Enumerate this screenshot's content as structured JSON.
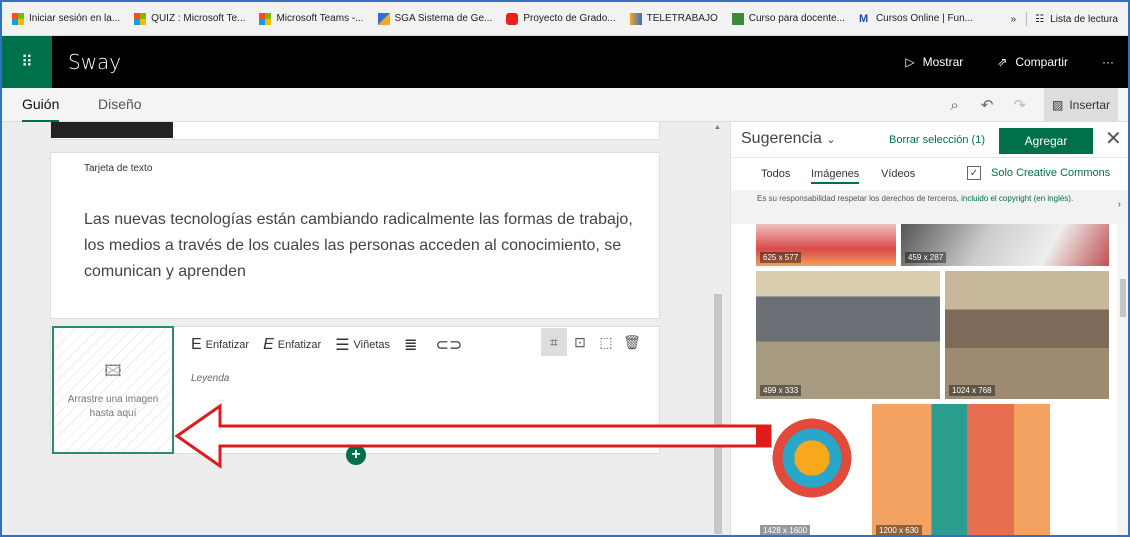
{
  "bookmarks": [
    {
      "label": "Iniciar sesión en la...",
      "icon": "microsoft-icon"
    },
    {
      "label": "QUIZ : Microsoft Te...",
      "icon": "microsoft-icon"
    },
    {
      "label": "Microsoft Teams -...",
      "icon": "microsoft-icon"
    },
    {
      "label": "SGA Sistema de Ge...",
      "icon": "sga-icon"
    },
    {
      "label": "Proyecto de Grado...",
      "icon": "youtube-icon"
    },
    {
      "label": "TELETRABAJO",
      "icon": "teletrabajo-icon"
    },
    {
      "label": "Curso para docente...",
      "icon": "course-icon"
    },
    {
      "label": "Cursos Online | Fun...",
      "icon": "cursos-icon"
    }
  ],
  "bookmarks_more": "»",
  "reading_list": "Lista de lectura",
  "app": {
    "name": "Sway",
    "show": "Mostrar",
    "share": "Compartir",
    "more": "···"
  },
  "tabs": {
    "storyline": "Guión",
    "design": "Diseño"
  },
  "insert": "Insertar",
  "text_card": {
    "label": "Tarjeta de texto",
    "body": "Las nuevas tecnologías están cambiando radicalmente las formas de trabajo, los medios a través de los cuales las personas acceden al conocimiento, se comunican y aprenden"
  },
  "media_card": {
    "drop_text": "Arrastre una imagen hasta aquí",
    "emphasize1": "Enfatizar",
    "emphasize2": "Enfatizar",
    "bullets": "Viñetas",
    "caption_placeholder": "Leyenda"
  },
  "panel": {
    "suggestion": "Sugerencia",
    "clear": "Borrar selección (1)",
    "add": "Agregar",
    "tabs": [
      "Todos",
      "Imágenes",
      "Vídeos"
    ],
    "creative_commons": "Solo Creative Commons",
    "notice": "Es su responsabilidad respetar los derechos de terceros,",
    "notice_link": "incluido el copyright (en inglés).",
    "images": [
      {
        "dims": "625 x 577"
      },
      {
        "dims": "459 x 287"
      },
      {
        "dims": "499 x 333"
      },
      {
        "dims": "1024 x 768"
      },
      {
        "dims": "1428 x 1600"
      },
      {
        "dims": "1200 x 630"
      }
    ]
  },
  "colors": {
    "accent": "#00704a",
    "arrow": "#e01b1b"
  }
}
